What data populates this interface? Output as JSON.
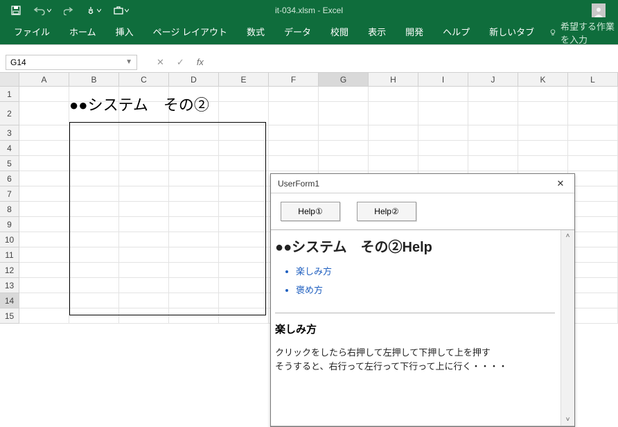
{
  "app_title": "it-034.xlsm  -  Excel",
  "qat": {
    "save": "save",
    "undo": "undo",
    "redo": "redo",
    "hand": "touch",
    "case": "briefcase"
  },
  "ribbon": {
    "tabs": [
      "ファイル",
      "ホーム",
      "挿入",
      "ページ レイアウト",
      "数式",
      "データ",
      "校閲",
      "表示",
      "開発",
      "ヘルプ",
      "新しいタブ"
    ],
    "tell_me": "希望する作業を入力"
  },
  "namebox": {
    "value": "G14"
  },
  "columns": [
    "A",
    "B",
    "C",
    "D",
    "E",
    "F",
    "G",
    "H",
    "I",
    "J",
    "K",
    "L"
  ],
  "rows": [
    1,
    2,
    3,
    4,
    5,
    6,
    7,
    8,
    9,
    10,
    11,
    12,
    13,
    14,
    15
  ],
  "active_cell": {
    "col": "G",
    "row": 14
  },
  "sheet": {
    "heading": "●●システム　その②"
  },
  "userform": {
    "title": "UserForm1",
    "buttons": {
      "help1": "Help①",
      "help2": "Help②"
    },
    "h1": "●●システム　その②Help",
    "links": [
      "楽しみ方",
      "褒め方"
    ],
    "section_title": "楽しみ方",
    "section_body": "クリックをしたら右押して左押して下押して上を押す\nそうすると、右行って左行って下行って上に行く・・・・"
  }
}
